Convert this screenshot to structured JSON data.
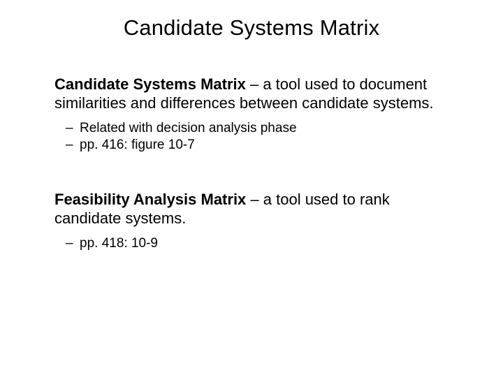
{
  "title": "Candidate Systems Matrix",
  "block1": {
    "term": "Candidate Systems Matrix",
    "rest": " – a tool used to document similarities and differences between candidate systems.",
    "sub1": "Related with decision analysis phase",
    "sub2": "pp. 416: figure 10-7"
  },
  "block2": {
    "term": "Feasibility Analysis Matrix",
    "rest": " – a tool used to rank candidate systems.",
    "sub1": "pp. 418: 10-9"
  }
}
